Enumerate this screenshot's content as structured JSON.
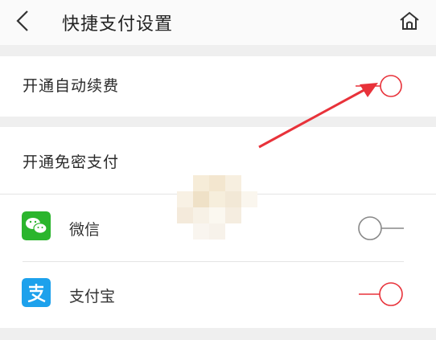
{
  "header": {
    "title": "快捷支付设置",
    "back_icon": "chevron-left-icon",
    "home_icon": "home-icon"
  },
  "auto_renew": {
    "label": "开通自动续费",
    "enabled": true
  },
  "password_free": {
    "label": "开通免密支付",
    "methods": [
      {
        "name": "微信",
        "icon": "wechat-icon",
        "enabled": false
      },
      {
        "name": "支付宝",
        "icon": "alipay-icon",
        "enabled": true
      }
    ]
  },
  "colors": {
    "accent": "#e8323a",
    "wechat": "#2bb52d",
    "alipay": "#1da1ec",
    "toggle_off": "#888888"
  }
}
